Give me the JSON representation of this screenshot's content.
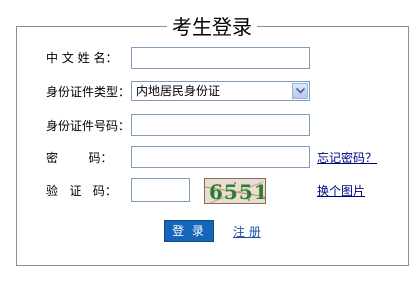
{
  "form": {
    "title": "考生登录",
    "name_label": "中 文 姓 名：",
    "name_value": "",
    "id_type_label": "身份证件类型：",
    "id_type_selected": "内地居民身份证",
    "id_number_label": "身份证件号码：",
    "id_number_value": "",
    "password_label": "密        码：",
    "password_value": "",
    "forgot_password_link": "忘记密码？",
    "captcha_label": "验   证   码：",
    "captcha_value": "",
    "captcha_image_text": "6551",
    "change_image_link": "换个图片",
    "login_button": "登 录",
    "register_link": "注 册"
  },
  "colors": {
    "link": "#000080",
    "button_bg": "#1565b8",
    "input_border": "#7f9db9",
    "fieldset_border": "#8f8f8f"
  },
  "icons": {
    "select_arrow": "chevron-down-icon"
  }
}
